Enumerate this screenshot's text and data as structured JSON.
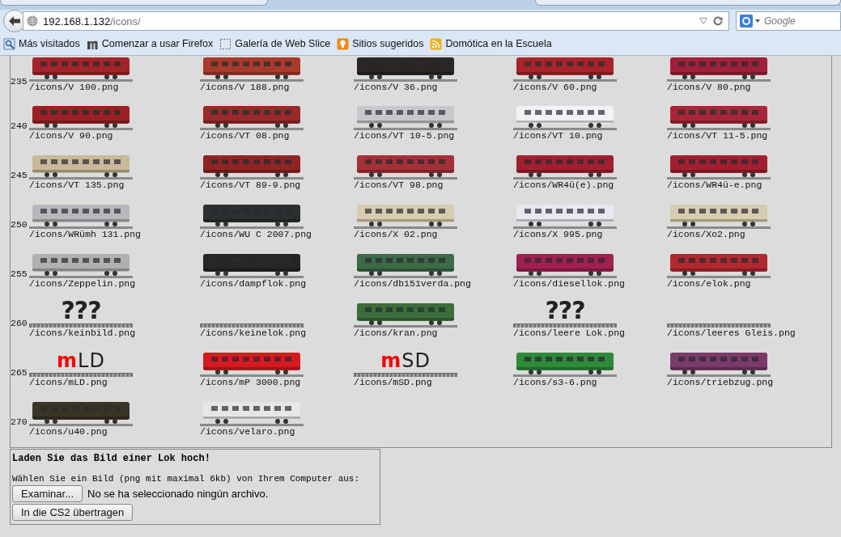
{
  "browser": {
    "url_host": "192.168.1.132",
    "url_path": "/icons/",
    "search_placeholder": "Google",
    "bookmarks": [
      {
        "label": "Más visitados",
        "kind": "star"
      },
      {
        "label": "Comenzar a usar Firefox",
        "kind": "m"
      },
      {
        "label": "Galería de Web Slice",
        "kind": "slice"
      },
      {
        "label": "Sitios sugeridos",
        "kind": "bulb"
      },
      {
        "label": "Domótica en la Escuela",
        "kind": "feed"
      }
    ]
  },
  "icon_rows": [
    {
      "number": "235",
      "items": [
        {
          "caption": "/icons/V 100.png",
          "kind": "train",
          "color": "#a3242a"
        },
        {
          "caption": "/icons/V 188.png",
          "kind": "train",
          "color": "#a83a2c"
        },
        {
          "caption": "/icons/V 36.png",
          "kind": "train",
          "color": "#2a2624"
        },
        {
          "caption": "/icons/V 60.png",
          "kind": "train",
          "color": "#a8232b"
        },
        {
          "caption": "/icons/V 80.png",
          "kind": "train",
          "color": "#a0203a"
        }
      ]
    },
    {
      "number": "240",
      "items": [
        {
          "caption": "/icons/V 90.png",
          "kind": "train",
          "color": "#9c1f24"
        },
        {
          "caption": "/icons/VT 08.png",
          "kind": "train",
          "color": "#9a2a2a"
        },
        {
          "caption": "/icons/VT 10-5.png",
          "kind": "train",
          "color": "#c8c8cc"
        },
        {
          "caption": "/icons/VT 10.png",
          "kind": "train",
          "color": "#f2f2f4"
        },
        {
          "caption": "/icons/VT 11-5.png",
          "kind": "train",
          "color": "#a82638"
        }
      ]
    },
    {
      "number": "245",
      "items": [
        {
          "caption": "/icons/VT 135.png",
          "kind": "train",
          "color": "#c9b99a"
        },
        {
          "caption": "/icons/VT 89-9.png",
          "kind": "train",
          "color": "#8e2424"
        },
        {
          "caption": "/icons/VT 98.png",
          "kind": "train",
          "color": "#a43038"
        },
        {
          "caption": "/icons/WR4ü(e).png",
          "kind": "train",
          "color": "#a02030"
        },
        {
          "caption": "/icons/WR4ü-e.png",
          "kind": "train",
          "color": "#a02030"
        }
      ]
    },
    {
      "number": "250",
      "items": [
        {
          "caption": "/icons/WRümh 131.png",
          "kind": "train",
          "color": "#b8b8bc"
        },
        {
          "caption": "/icons/WU C 2007.png",
          "kind": "train",
          "color": "#2c3030"
        },
        {
          "caption": "/icons/X 02.png",
          "kind": "train",
          "color": "#d8ccb0"
        },
        {
          "caption": "/icons/X 995.png",
          "kind": "train",
          "color": "#e8e8f0"
        },
        {
          "caption": "/icons/Xo2.png",
          "kind": "train",
          "color": "#d8ccb0"
        }
      ]
    },
    {
      "number": "255",
      "items": [
        {
          "caption": "/icons/Zeppelin.png",
          "kind": "train",
          "color": "#b0b0b0"
        },
        {
          "caption": "/icons/dampflok.png",
          "kind": "train",
          "color": "#262626"
        },
        {
          "caption": "/icons/db151verda.png",
          "kind": "train",
          "color": "#3e6a48"
        },
        {
          "caption": "/icons/diesellok.png",
          "kind": "train",
          "color": "#a02050"
        },
        {
          "caption": "/icons/elok.png",
          "kind": "train",
          "color": "#b02830"
        }
      ]
    },
    {
      "number": "260",
      "items": [
        {
          "caption": "/icons/keinbild.png",
          "kind": "question",
          "picture_text": "???"
        },
        {
          "caption": "/icons/keinelok.png",
          "kind": "blank"
        },
        {
          "caption": "/icons/kran.png",
          "kind": "train",
          "color": "#3c6e3c"
        },
        {
          "caption": "/icons/leere Lok.png",
          "kind": "question",
          "picture_text": "???"
        },
        {
          "caption": "/icons/leeres Gleis.png",
          "kind": "blank"
        }
      ]
    },
    {
      "number": "265",
      "items": [
        {
          "caption": "/icons/mLD.png",
          "kind": "logo",
          "accent": "m",
          "picture_text": "LD"
        },
        {
          "caption": "/icons/mP 3000.png",
          "kind": "train",
          "color": "#d41c20"
        },
        {
          "caption": "/icons/mSD.png",
          "kind": "logo",
          "accent": "m",
          "picture_text": "SD"
        },
        {
          "caption": "/icons/s3-6.png",
          "kind": "train",
          "color": "#2e8a3a"
        },
        {
          "caption": "/icons/triebzug.png",
          "kind": "train",
          "color": "#7a3a6a"
        }
      ]
    },
    {
      "number": "270",
      "items": [
        {
          "caption": "/icons/u40.png",
          "kind": "train",
          "color": "#3a3426"
        },
        {
          "caption": "/icons/velaro.png",
          "kind": "train",
          "color": "#e6e6e6"
        }
      ]
    }
  ],
  "upload": {
    "title": "Laden Sie das Bild einer Lok hoch!",
    "instruction": "Wählen Sie ein Bild (png mit maximal 6kb) von Ihrem Computer aus:",
    "browse_button": "Examinar...",
    "file_status": "No se ha seleccionado ningún archivo.",
    "submit_button": "In die CS2 übertragen"
  }
}
